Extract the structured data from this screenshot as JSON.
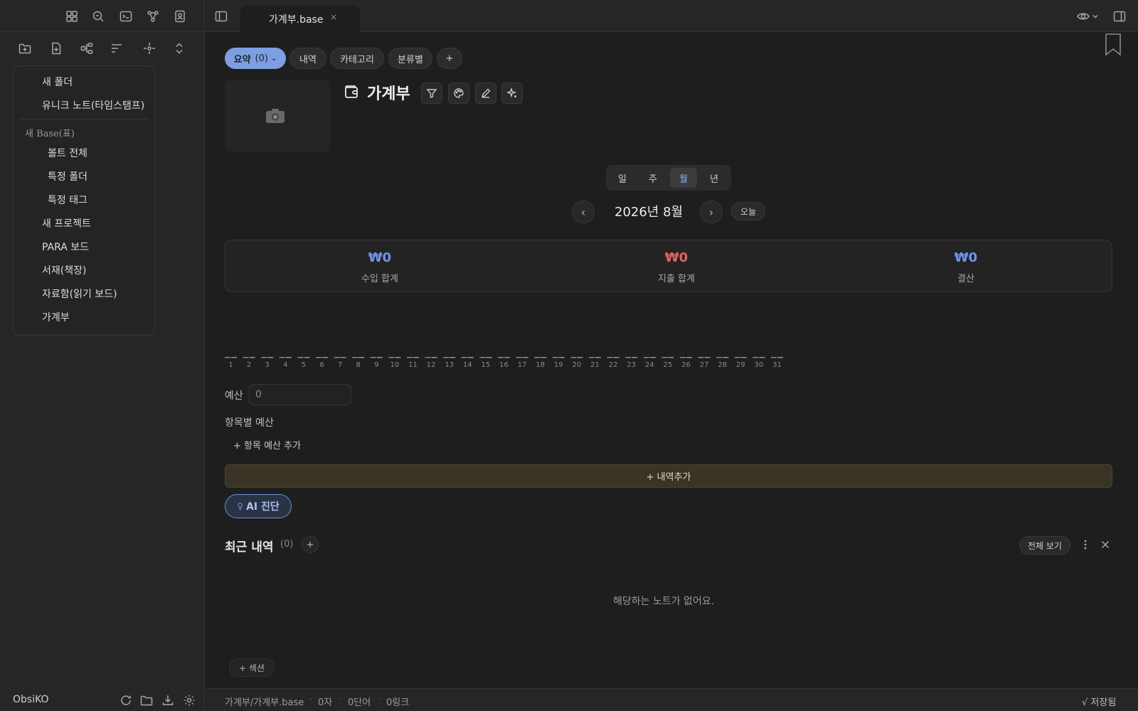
{
  "colors": {
    "income": "#6f95e8",
    "expense": "#e06363",
    "balance": "#6f95e8",
    "accent": "#7d9ee0"
  },
  "sidebar": {
    "top_icons": [
      "layout-grid-icon",
      "search-icon",
      "terminal-icon",
      "graph-icon",
      "contact-icon"
    ],
    "toolbar_icons": [
      "new-folder-icon",
      "new-note-icon",
      "mindmap-icon",
      "sort-icon",
      "focus-icon",
      "expand-collapse-icon"
    ],
    "menu": {
      "items": [
        "새 폴더",
        "유니크 노트(타임스탬프)"
      ],
      "base_group_label": "새 Base(표)",
      "base_items": [
        "볼트 전체",
        "특정 폴더",
        "특정 태그"
      ],
      "more_items": [
        "새 프로젝트",
        "PARA 보드",
        "서재(책장)",
        "자료함(읽기 보드)",
        "가계부"
      ]
    },
    "vault_name": "ObsiKO",
    "footer_icons": [
      "refresh-icon",
      "folder-icon",
      "download-icon",
      "settings-icon"
    ]
  },
  "tab": {
    "title": "가계부.base",
    "close": "×"
  },
  "views": {
    "items": [
      {
        "label": "요약",
        "count": "(0)",
        "active": true
      },
      {
        "label": "내역"
      },
      {
        "label": "카테고리"
      },
      {
        "label": "분류별"
      },
      {
        "label": "+"
      }
    ]
  },
  "page": {
    "title": "가계부"
  },
  "period": {
    "options": [
      "일",
      "주",
      "월",
      "년"
    ],
    "selected": "월",
    "current": "2026년 8월",
    "prev": "‹",
    "next": "›",
    "today_label": "오늘"
  },
  "summary": {
    "income": {
      "value": "₩0",
      "label": "수입 합계"
    },
    "expense": {
      "value": "₩0",
      "label": "지출 합계"
    },
    "balance": {
      "value": "₩0",
      "label": "결산"
    }
  },
  "chart_data": {
    "type": "bar",
    "categories": [
      "1",
      "2",
      "3",
      "4",
      "5",
      "6",
      "7",
      "8",
      "9",
      "10",
      "11",
      "12",
      "13",
      "14",
      "15",
      "16",
      "17",
      "18",
      "19",
      "20",
      "21",
      "22",
      "23",
      "24",
      "25",
      "26",
      "27",
      "28",
      "29",
      "30",
      "31"
    ],
    "series": [
      {
        "values": [
          0,
          0,
          0,
          0,
          0,
          0,
          0,
          0,
          0,
          0,
          0,
          0,
          0,
          0,
          0,
          0,
          0,
          0,
          0,
          0,
          0,
          0,
          0,
          0,
          0,
          0,
          0,
          0,
          0,
          0,
          0
        ],
        "color": "#e06363"
      },
      {
        "values": [
          0,
          0,
          0,
          0,
          0,
          0,
          0,
          0,
          0,
          0,
          0,
          0,
          0,
          0,
          0,
          0,
          0,
          0,
          0,
          0,
          0,
          0,
          0,
          0,
          0,
          0,
          0,
          0,
          0,
          0,
          0
        ],
        "color": "#6f95e8"
      }
    ]
  },
  "budget": {
    "label": "예산",
    "input_value": "0",
    "category_title": "항목별 예산",
    "add_category": "+ 항목 예산 추가"
  },
  "actions": {
    "add_entry": "+ 내역추가",
    "ai_diagnosis": "AI 진단"
  },
  "recent": {
    "title": "최근 내역",
    "count": "(0)",
    "add": "+",
    "view_all": "전체 보기",
    "empty": "해당하는 노트가 없어요."
  },
  "add_section": "+ 섹션",
  "status": {
    "path": "가계부/가계부.base",
    "chars": "0자",
    "words": "0단어",
    "links": "0링크",
    "saved": "√ 저장됨"
  }
}
